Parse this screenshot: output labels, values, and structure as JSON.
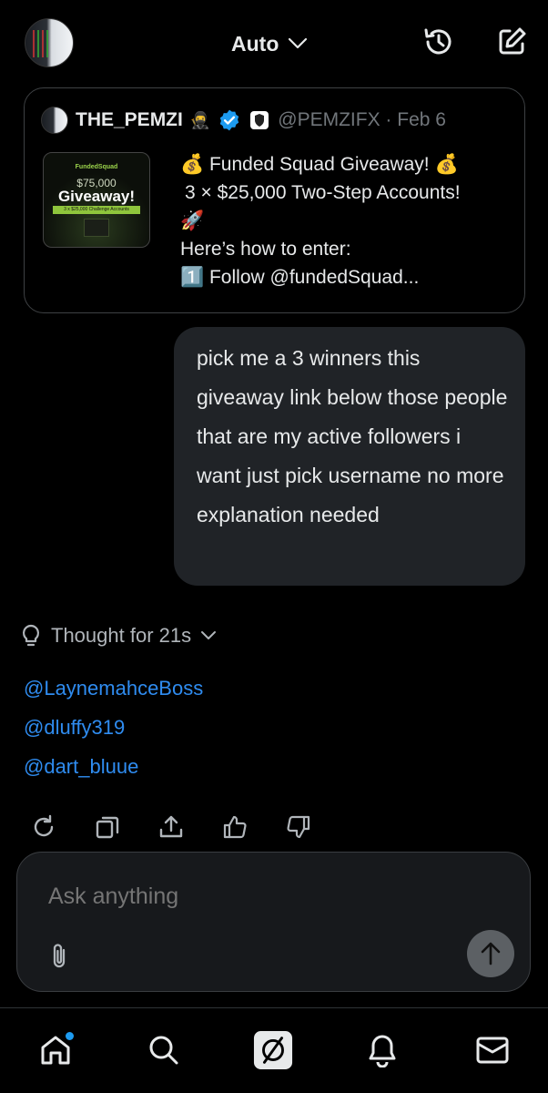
{
  "header": {
    "model_label": "Auto",
    "icons": [
      "history-icon",
      "edit-icon"
    ]
  },
  "quote": {
    "name": "THE_PEMZI",
    "ninja": "🥷",
    "badge": "🛡",
    "handle_date": "@PEMZIFX · Feb 6",
    "thumbnail": {
      "brand": "FundedSquad",
      "amount": "$75,000",
      "headline": "Giveaway!",
      "strip": "3 x $25,000 Challenge Accounts"
    },
    "lines": [
      "💰 Funded Squad Giveaway! 💰",
      "3 × $25,000 Two-Step Accounts!",
      "🚀",
      "Here’s how to enter:",
      "1️⃣ Follow @fundedSquad..."
    ]
  },
  "user_message": "pick me a 3 winners  this giveaway link below those people that are my active followers i want just pick username no more explanation needed",
  "thought": {
    "label": "Thought for 21s"
  },
  "answers": [
    "@LaynemahceBoss",
    "@dluffy319",
    "@dart_bluue"
  ],
  "actions": [
    "regenerate-icon",
    "copy-icon",
    "share-icon",
    "thumbs-up-icon",
    "thumbs-down-icon"
  ],
  "composer": {
    "placeholder": "Ask anything"
  },
  "colors": {
    "accent": "#1d9bf0",
    "link": "#2f8cf0",
    "bubble": "#202327"
  },
  "bottom_nav": [
    "home-icon",
    "search-icon",
    "grok-icon",
    "notifications-icon",
    "messages-icon"
  ]
}
